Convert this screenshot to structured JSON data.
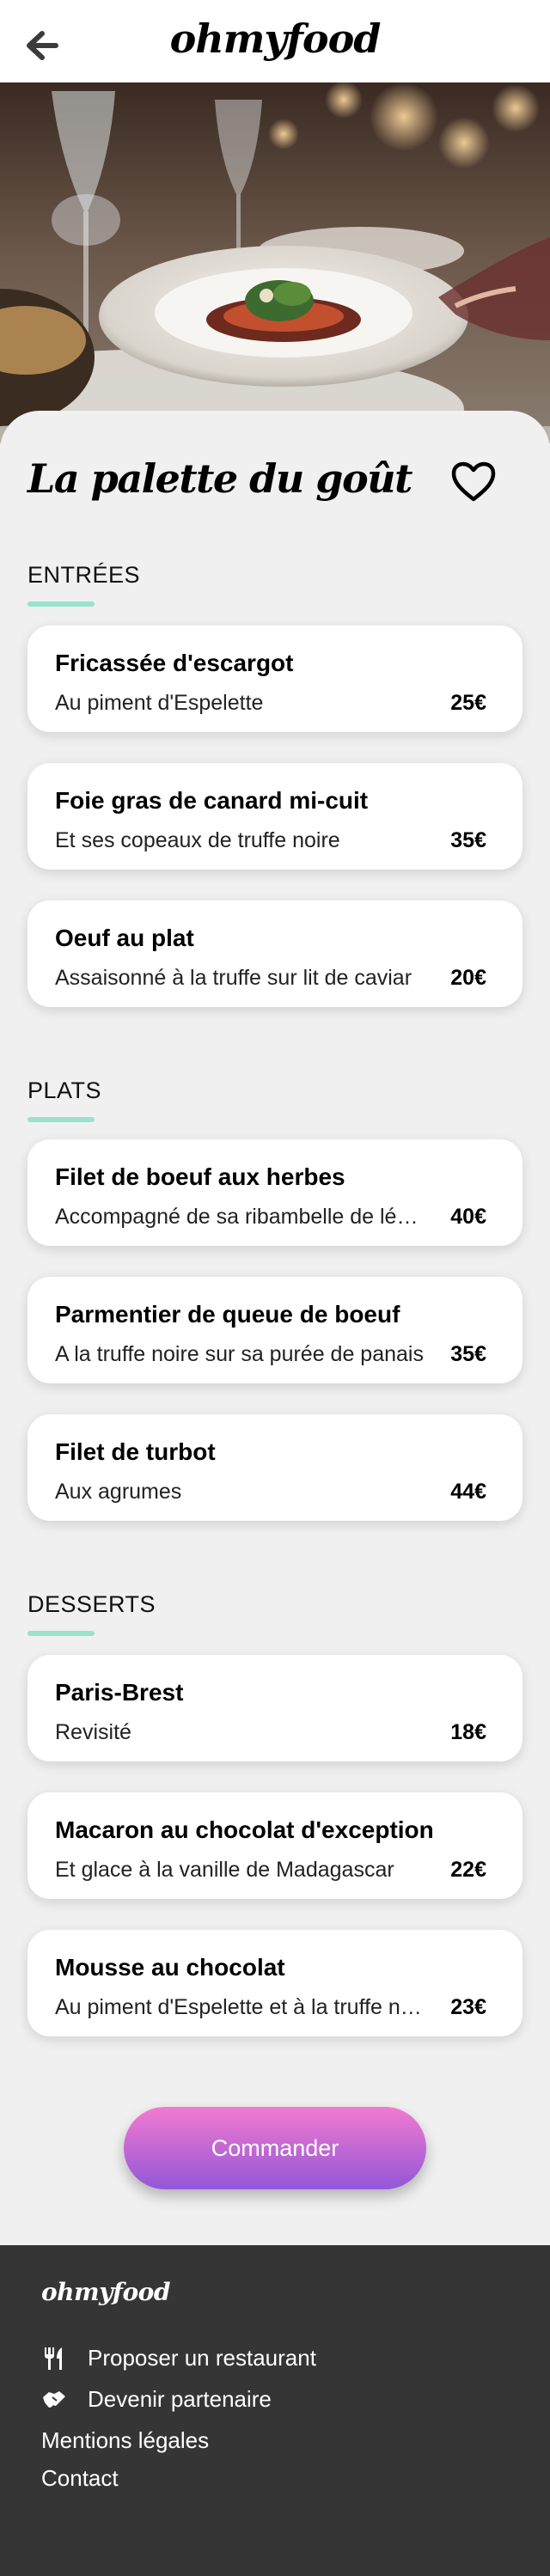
{
  "header": {
    "logo": "ohmyfood",
    "back_icon": "arrow-left-icon"
  },
  "restaurant": {
    "name": "La palette du goût",
    "favorite_icon": "heart-outline-icon"
  },
  "sections": [
    {
      "title": "ENTRÉES",
      "dishes": [
        {
          "name": "Fricassée d'escargot",
          "description": "Au piment d'Espelette",
          "price": "25€"
        },
        {
          "name": "Foie gras de canard mi-cuit",
          "description": "Et ses copeaux de truffe noire",
          "price": "35€"
        },
        {
          "name": "Oeuf au plat",
          "description": "Assaisonné à la truffe sur lit de caviar",
          "price": "20€"
        }
      ]
    },
    {
      "title": "PLATS",
      "dishes": [
        {
          "name": "Filet de boeuf aux herbes",
          "description": "Accompagné de sa ribambelle de légumes",
          "price": "40€"
        },
        {
          "name": "Parmentier de queue de boeuf",
          "description": "A la truffe noire sur sa purée de panais",
          "price": "35€"
        },
        {
          "name": "Filet de turbot",
          "description": "Aux agrumes",
          "price": "44€"
        }
      ]
    },
    {
      "title": "DESSERTS",
      "dishes": [
        {
          "name": "Paris-Brest",
          "description": "Revisité",
          "price": "18€"
        },
        {
          "name": "Macaron au chocolat d'exception",
          "description": "Et glace à la vanille de Madagascar",
          "price": "22€"
        },
        {
          "name": "Mousse au chocolat",
          "description": "Au piment d'Espelette et à la truffe noire",
          "price": "23€"
        }
      ]
    }
  ],
  "order_button": {
    "label": "Commander"
  },
  "footer": {
    "logo": "ohmyfood",
    "links": [
      {
        "label": "Proposer un restaurant",
        "icon": "utensils-icon"
      },
      {
        "label": "Devenir partenaire",
        "icon": "handshake-icon"
      },
      {
        "label": "Mentions légales"
      },
      {
        "label": "Contact"
      }
    ]
  },
  "colors": {
    "accent_underline": "#99e2d0",
    "button_gradient_top": "#f37ad0",
    "button_gradient_bottom": "#9357d8",
    "footer_bg": "#353535",
    "page_bg": "#f0f0f0"
  }
}
